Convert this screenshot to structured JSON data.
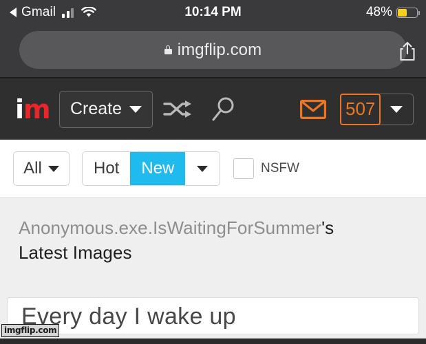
{
  "status_bar": {
    "back_app": "Gmail",
    "back_arrow_icon": "triangle-left-icon",
    "signal_icon": "cellular-signal-icon",
    "wifi_icon": "wifi-icon",
    "time": "10:14 PM",
    "battery_percent": "48%",
    "battery_icon": "battery-low-power-icon",
    "battery_fill_color": "#f7cf1e",
    "bg_color": "#3a3a3c"
  },
  "browser": {
    "lock_icon": "lock-icon",
    "url": "imgflip.com",
    "share_icon": "share-icon"
  },
  "nav": {
    "logo_first": "i",
    "logo_second": "m",
    "logo_color_first": "#ffffff",
    "logo_color_second": "#e8262b",
    "create_label": "Create",
    "create_caret_icon": "chevron-down-icon",
    "shuffle_icon": "shuffle-icon",
    "search_icon": "search-icon",
    "mail_icon": "envelope-icon",
    "mail_color": "#ed7623",
    "points": "507",
    "points_color": "#ed7623",
    "user_caret_icon": "chevron-down-icon",
    "bg_color": "#2f2f2f"
  },
  "filters": {
    "all_label": "All",
    "all_caret_icon": "chevron-down-icon",
    "sort_options": [
      "Hot",
      "New"
    ],
    "sort_active": "New",
    "sort_active_color": "#1fbbee",
    "sort_caret_icon": "chevron-down-icon",
    "nsfw_label": "NSFW",
    "nsfw_checked": false
  },
  "content": {
    "username": "Anonymous.exe.IsWaitingForSummer",
    "title_suffix": "'s",
    "title_line2": "Latest Images",
    "username_color": "#8e8e8e",
    "bg_color": "#efefef"
  },
  "meme": {
    "caption": "Every day I wake up",
    "watermark": "imgflip.com"
  }
}
